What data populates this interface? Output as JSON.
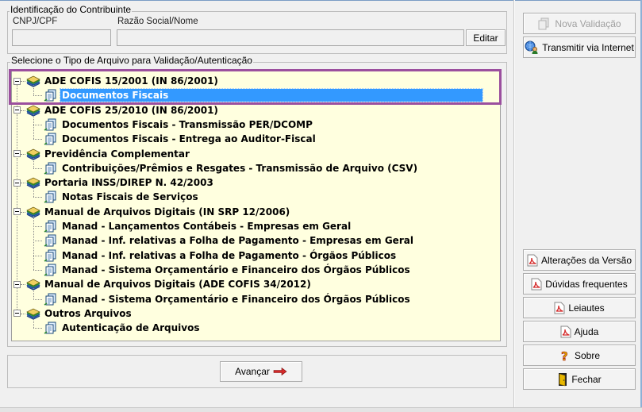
{
  "contribuinte": {
    "group_title": "Identificação do Contribuinte",
    "cnpj_label": "CNPJ/CPF",
    "cnpj_value": "",
    "razao_label": "Razão Social/Nome",
    "razao_value": "",
    "editar_label": "Editar"
  },
  "tipo_arquivo": {
    "group_title": "Selecione o Tipo de Arquivo para Validação/Autenticação",
    "tree": [
      {
        "label": "ADE COFIS 15/2001 (IN 86/2001)",
        "children": [
          {
            "label": "Documentos Fiscais",
            "selected": true
          }
        ]
      },
      {
        "label": "ADE COFIS 25/2010 (IN 86/2001)",
        "children": [
          {
            "label": "Documentos Fiscais - Transmissão PER/DCOMP"
          },
          {
            "label": "Documentos Fiscais - Entrega ao Auditor-Fiscal"
          }
        ]
      },
      {
        "label": "Previdência Complementar",
        "children": [
          {
            "label": "Contribuições/Prêmios e Resgates - Transmissão de Arquivo (CSV)"
          }
        ]
      },
      {
        "label": "Portaria INSS/DIREP N. 42/2003",
        "children": [
          {
            "label": "Notas Fiscais de Serviços"
          }
        ]
      },
      {
        "label": "Manual de Arquivos Digitais (IN SRP 12/2006)",
        "children": [
          {
            "label": "Manad - Lançamentos Contábeis - Empresas em Geral"
          },
          {
            "label": "Manad - Inf. relativas a Folha de Pagamento - Empresas em Geral"
          },
          {
            "label": "Manad - Inf. relativas a Folha de Pagamento - Órgãos Públicos"
          },
          {
            "label": "Manad - Sistema Orçamentário e Financeiro dos Órgãos Públicos"
          }
        ]
      },
      {
        "label": "Manual de Arquivos Digitais (ADE COFIS 34/2012)",
        "children": [
          {
            "label": "Manad - Sistema Orçamentário e Financeiro dos Órgãos Públicos"
          }
        ]
      },
      {
        "label": "Outros Arquivos",
        "children": [
          {
            "label": "Autenticação de Arquivos"
          }
        ]
      }
    ]
  },
  "avancar_label": "Avançar",
  "side_buttons": {
    "nova_validacao": "Nova Validação",
    "transmitir": "Transmitir via Internet",
    "alteracoes": "Alterações da Versão",
    "duvidas": "Dúvidas frequentes",
    "leiautes": "Leiautes",
    "ajuda": "Ajuda",
    "sobre": "Sobre",
    "fechar": "Fechar"
  },
  "colors": {
    "tree_background": "#ffffdf",
    "selection": "#3399ff",
    "highlight_border": "#9b4f9e",
    "pdf_red": "#d42a2a"
  },
  "icons": {
    "group_node": "books-icon",
    "leaf_node": "document-icon",
    "pdf": "pdf-icon",
    "help": "question-icon",
    "exit": "door-icon",
    "next": "arrow-right-icon"
  }
}
